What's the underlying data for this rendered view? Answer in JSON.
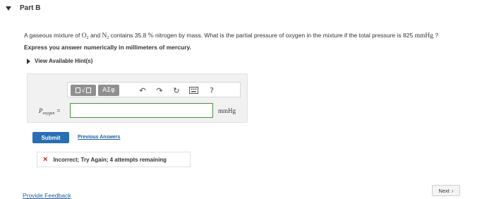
{
  "part": {
    "title": "Part B"
  },
  "question": {
    "text_1": "A gaseous mixture of ",
    "o2_base": "O",
    "o2_sub": "2",
    "text_2": " and ",
    "n2_base": "N",
    "n2_sub": "2",
    "text_3": " contains 35.8 ",
    "percent": "%",
    "text_4": " nitrogen by mass. What is the partial pressure of oxygen in the mixture if the total pressure is 825 ",
    "unit": "mmHg",
    "text_5": " ?",
    "instruction": "Express you answer numerically in millimeters of mercury."
  },
  "hints": {
    "label": "View Available Hint(s)"
  },
  "toolbar": {
    "greek_label": "ΑΣφ",
    "undo_icon": "undo-arrow",
    "redo_icon": "redo-arrow",
    "reset_icon": "reset-circle",
    "keyboard_icon": "keyboard",
    "help_label": "?"
  },
  "answer": {
    "label_base": "P",
    "label_sub": "oxygen",
    "label_eq": " =",
    "value": "",
    "units": "mmHg"
  },
  "actions": {
    "submit_label": "Submit",
    "previous_answers_label": "Previous Answers"
  },
  "feedback": {
    "icon": "×",
    "text": "Incorrect; Try Again; 4 attempts remaining"
  },
  "footer": {
    "provide_feedback_label": "Provide Feedback",
    "next_label": "Next",
    "next_glyph": "›"
  },
  "colors": {
    "accent": "#2a6fb2",
    "input_border": "#4d8f3f",
    "error": "#c02020"
  }
}
